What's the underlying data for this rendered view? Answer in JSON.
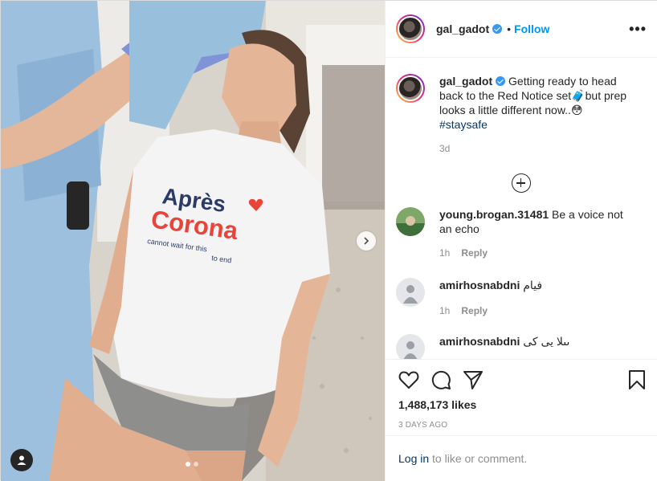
{
  "post": {
    "author": {
      "username": "gal_gadot",
      "verified": true,
      "separator": "•",
      "follow_label": "Follow"
    },
    "caption": {
      "username": "gal_gadot",
      "text_a": "Getting ready to head back to the Red Notice set",
      "emoji_a": "🧳",
      "text_b": "but prep looks a little different now..",
      "emoji_b": "😳",
      "hashtag": "#staysafe",
      "age": "3d"
    },
    "comments": [
      {
        "username": "young.brogan.31481",
        "text": "Be a voice not an echo",
        "age": "1h",
        "reply_label": "Reply"
      },
      {
        "username": "amirhosnabdni",
        "text": "فیام",
        "age": "1h",
        "reply_label": "Reply"
      },
      {
        "username": "amirhosnabdni",
        "text": "ىىلا يى كى",
        "age": "",
        "reply_label": ""
      }
    ],
    "likes": "1,488,173 likes",
    "date": "3 DAYS AGO",
    "login_link": "Log in",
    "login_suffix": " to like or comment.",
    "shirt_text": {
      "line1": "Après",
      "line2": "Corona",
      "line3": "cannot wait for this",
      "line4": "to end"
    },
    "carousel": {
      "count": 2,
      "active": 1
    },
    "colors": {
      "follow_blue": "#0095f6",
      "verified_blue": "#3897f0",
      "shirt_navy": "#2b3a67",
      "shirt_red": "#e8443a"
    },
    "icons": [
      "heart-icon",
      "comment-icon",
      "share-icon",
      "bookmark-icon",
      "more-options-icon",
      "add-comments-icon",
      "chevron-right-icon",
      "user-tag-icon"
    ]
  }
}
